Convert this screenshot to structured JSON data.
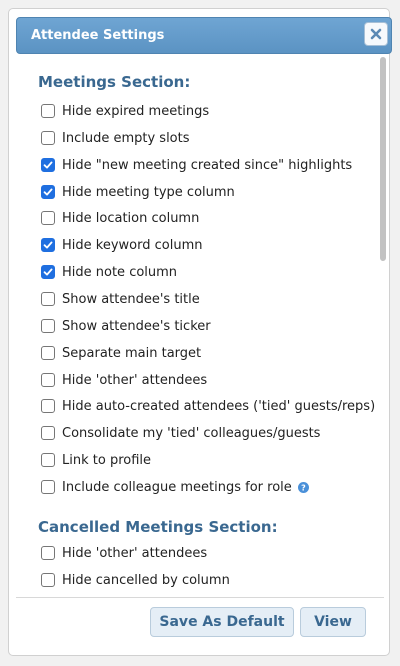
{
  "dialog": {
    "title": "Attendee Settings",
    "close_icon": "close-x-icon"
  },
  "sections": [
    {
      "heading": "Meetings Section:",
      "options": [
        {
          "label": "Hide expired meetings",
          "checked": false
        },
        {
          "label": "Include empty slots",
          "checked": false
        },
        {
          "label": "Hide \"new meeting created since\" highlights",
          "checked": true
        },
        {
          "label": "Hide meeting type column",
          "checked": true
        },
        {
          "label": "Hide location column",
          "checked": false
        },
        {
          "label": "Hide keyword column",
          "checked": true
        },
        {
          "label": "Hide note column",
          "checked": true
        },
        {
          "label": "Show attendee's title",
          "checked": false
        },
        {
          "label": "Show attendee's ticker",
          "checked": false
        },
        {
          "label": "Separate main target",
          "checked": false
        },
        {
          "label": "Hide 'other' attendees",
          "checked": false
        },
        {
          "label": "Hide auto-created attendees ('tied' guests/reps)",
          "checked": false
        },
        {
          "label": "Consolidate my 'tied' colleagues/guests",
          "checked": false
        },
        {
          "label": "Link to profile",
          "checked": false
        },
        {
          "label": "Include colleague meetings for role",
          "checked": false,
          "help_icon": "help-circle-icon"
        }
      ]
    },
    {
      "heading": "Cancelled Meetings Section:",
      "options": [
        {
          "label": "Hide 'other' attendees",
          "checked": false
        },
        {
          "label": "Hide cancelled by column",
          "checked": false
        }
      ]
    }
  ],
  "footer": {
    "save_default_label": "Save As Default",
    "view_label": "View"
  },
  "colors": {
    "title_bar": "#5b93c3",
    "heading": "#3a6890",
    "checkbox_checked": "#1f6fe0",
    "help_icon": "#4a90d9"
  }
}
